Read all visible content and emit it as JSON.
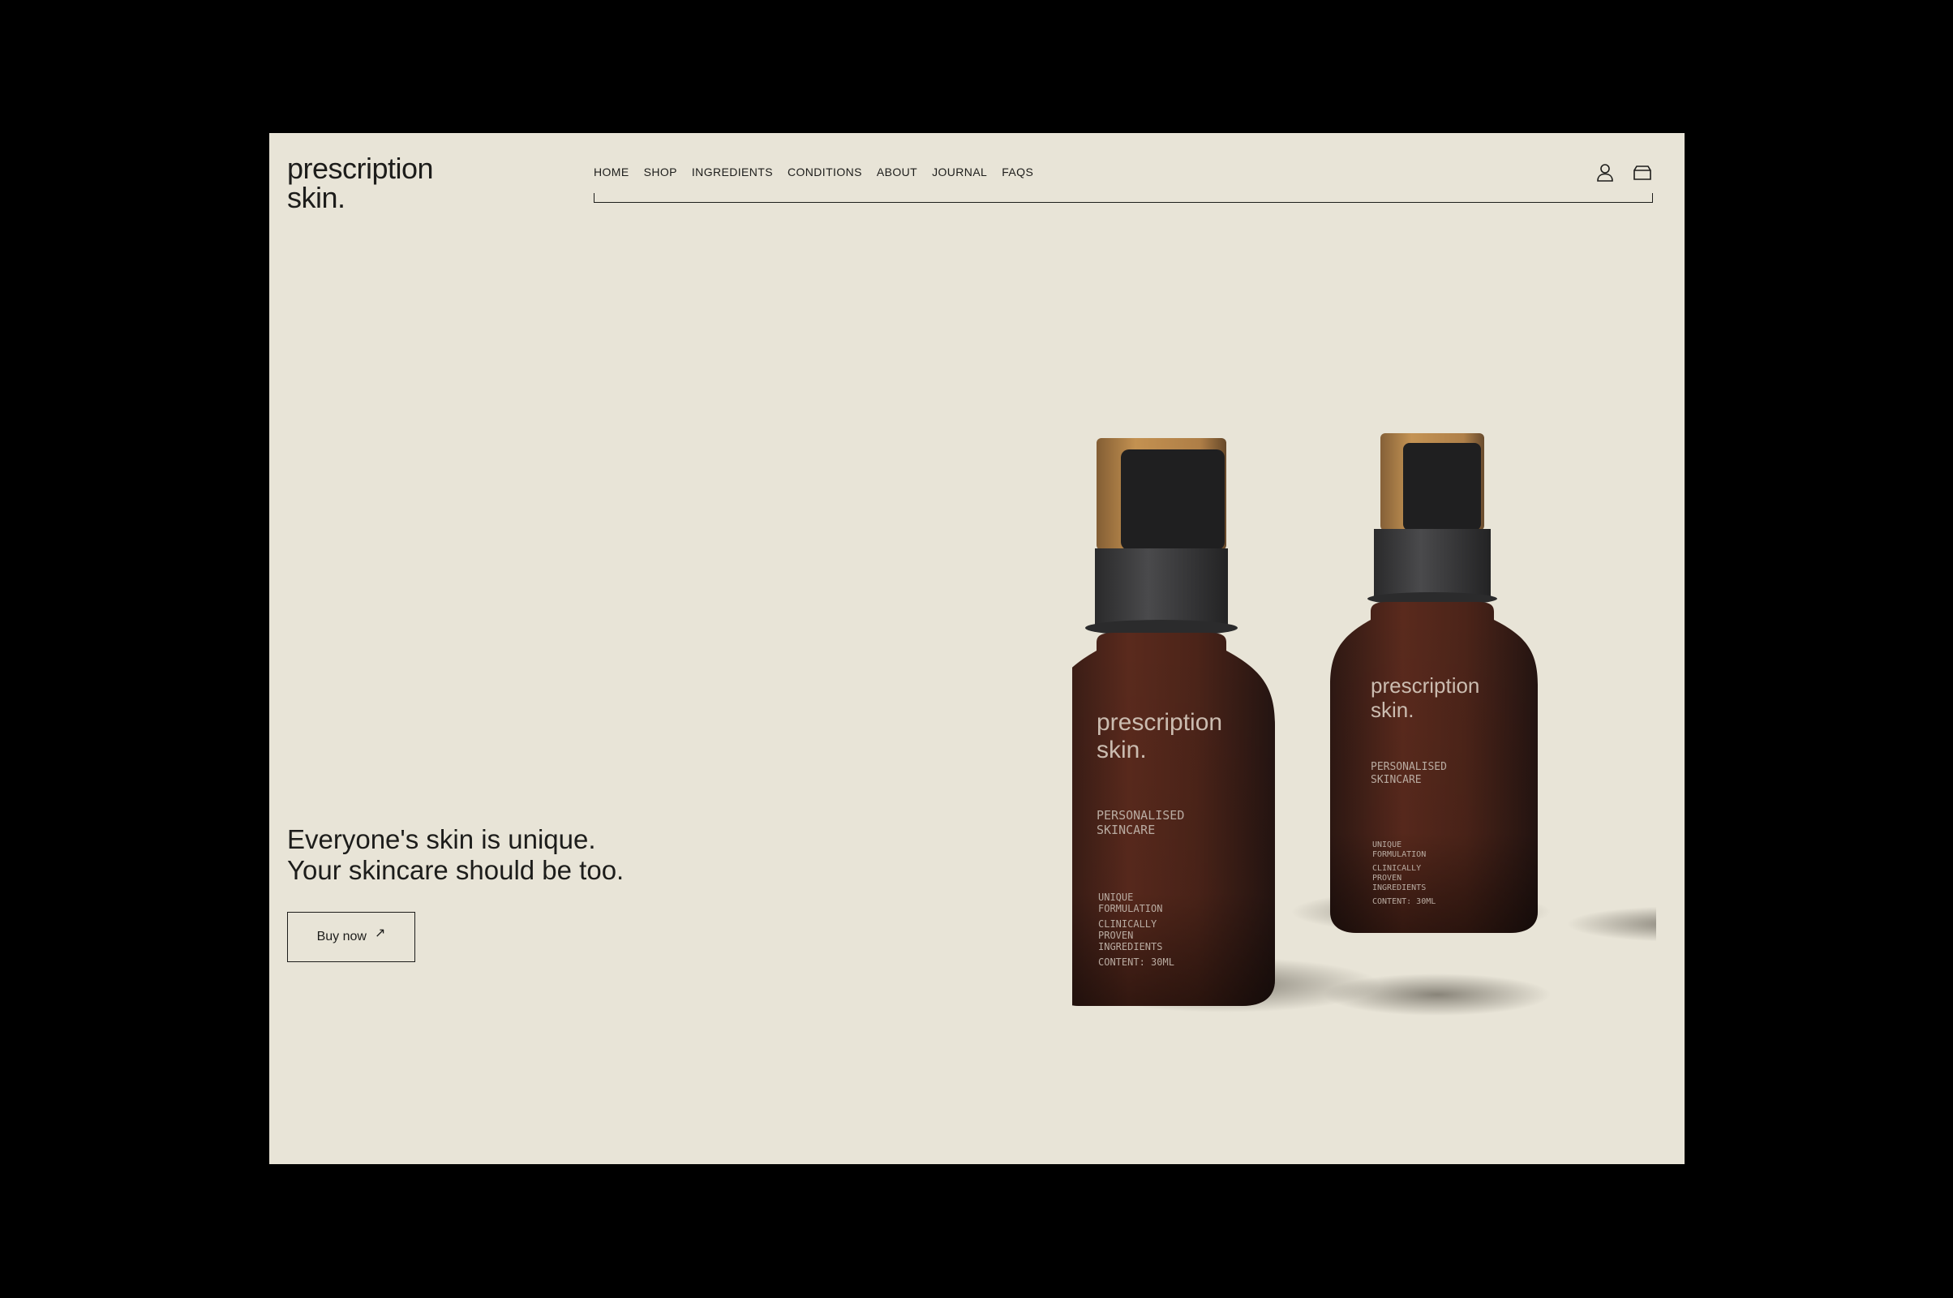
{
  "brand": {
    "logo_line1": "prescription",
    "logo_line2": "skin."
  },
  "nav": {
    "items": [
      {
        "label": "HOME"
      },
      {
        "label": "SHOP"
      },
      {
        "label": "INGREDIENTS"
      },
      {
        "label": "CONDITIONS"
      },
      {
        "label": "ABOUT"
      },
      {
        "label": "JOURNAL"
      },
      {
        "label": "FAQS"
      }
    ]
  },
  "header_icons": {
    "account": "user-icon",
    "cart": "cart-icon"
  },
  "hero": {
    "headline_line1": "Everyone's skin is unique.",
    "headline_line2": "Your skincare should be too.",
    "cta_label": "Buy now",
    "cta_icon": "arrow-up-right-icon"
  },
  "product_label": {
    "brand_line1": "prescription",
    "brand_line2": "skin.",
    "subtitle_line1": "PERSONALISED",
    "subtitle_line2": "SKINCARE",
    "note1_line1": "UNIQUE",
    "note1_line2": "FORMULATION",
    "note2_line1": "CLINICALLY",
    "note2_line2": "PROVEN",
    "note2_line3": "INGREDIENTS",
    "content": "CONTENT: 30ML"
  },
  "colors": {
    "background": "#e8e4d7",
    "frame": "#000000",
    "text": "#1d1d1b",
    "bottle": "#4a231a",
    "cap": "#c08a45"
  }
}
